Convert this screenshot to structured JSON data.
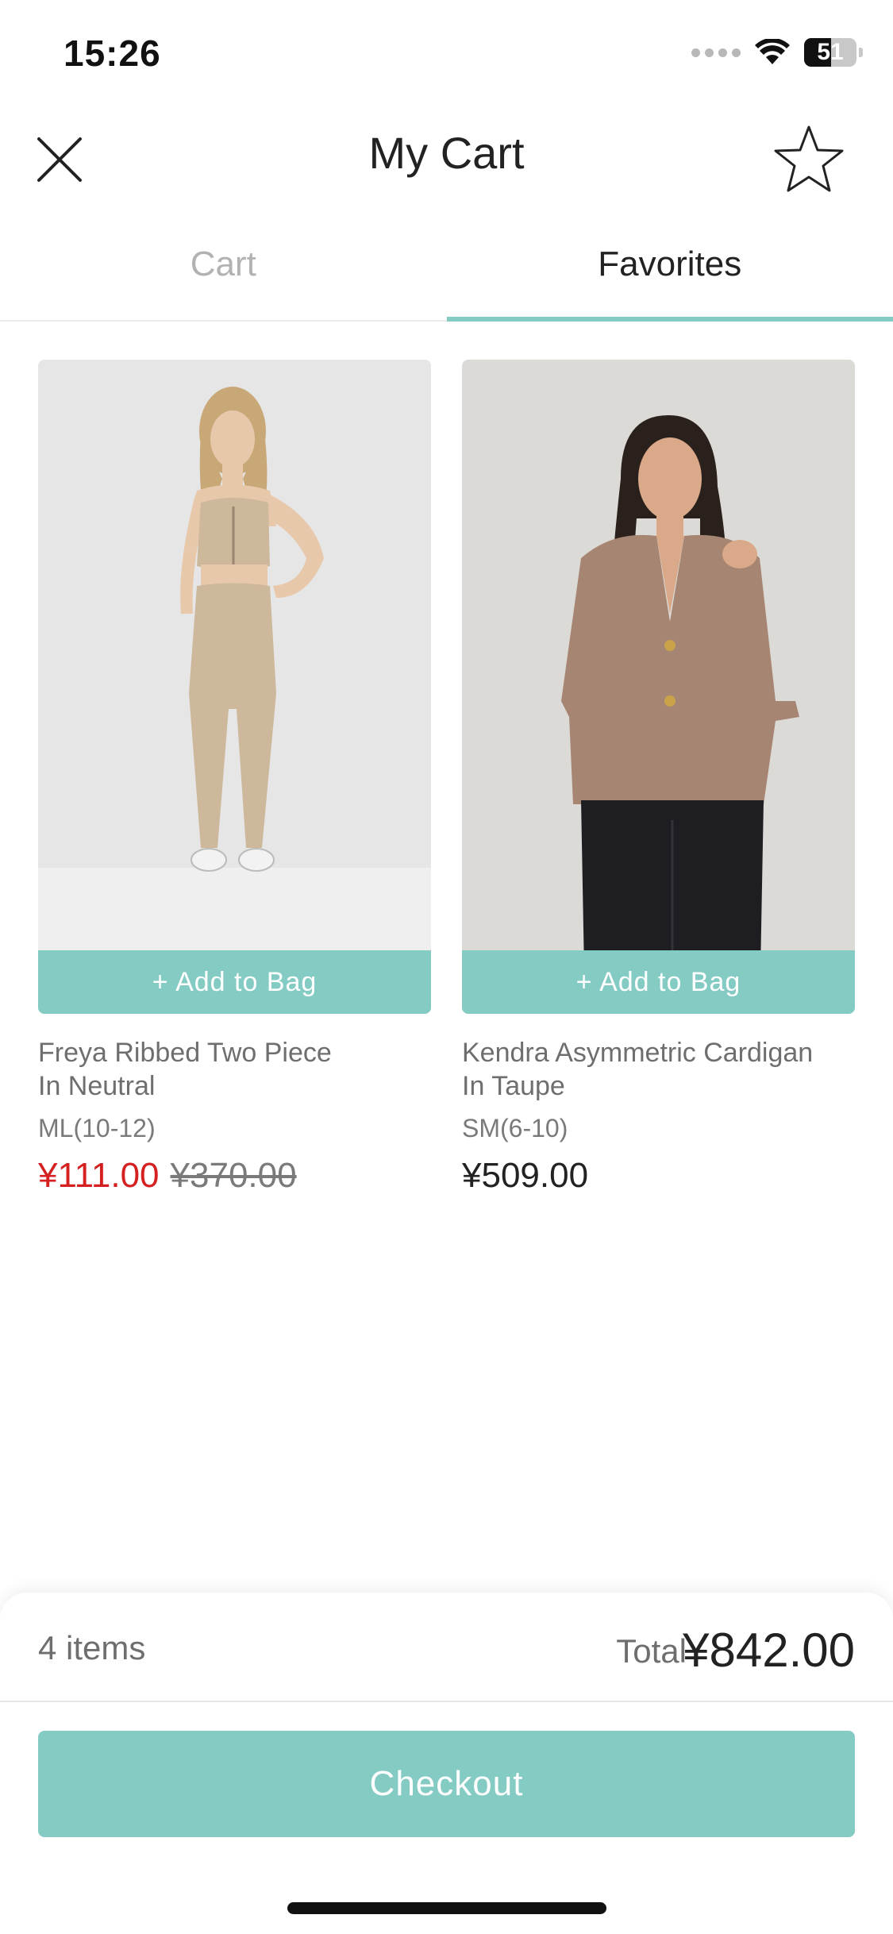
{
  "status_bar": {
    "time": "15:26",
    "battery_level": "51",
    "icons": [
      "signal-dots-icon",
      "wifi-icon",
      "battery-icon"
    ]
  },
  "header": {
    "title": "My Cart",
    "close_icon": "close-icon",
    "favorite_icon": "star-icon"
  },
  "tabs": [
    {
      "label": "Cart",
      "active": false
    },
    {
      "label": "Favorites",
      "active": true
    }
  ],
  "products": [
    {
      "add_label": "+ Add to Bag",
      "name_line1": "Freya Ribbed Two Piece",
      "name_line2": "In Neutral",
      "size": "ML(10-12)",
      "sale_price": "¥111.00",
      "original_price": "¥370.00"
    },
    {
      "add_label": "+ Add to Bag",
      "name_line1": "Kendra Asymmetric Cardigan",
      "name_line2": "In Taupe",
      "size": "SM(6-10)",
      "price": "¥509.00"
    }
  ],
  "summary": {
    "items": "4 items",
    "total_label": "Total",
    "total_amount": "¥842.00",
    "checkout_label": "Checkout"
  },
  "colors": {
    "accent": "#84cbc4",
    "sale": "#d42020"
  }
}
